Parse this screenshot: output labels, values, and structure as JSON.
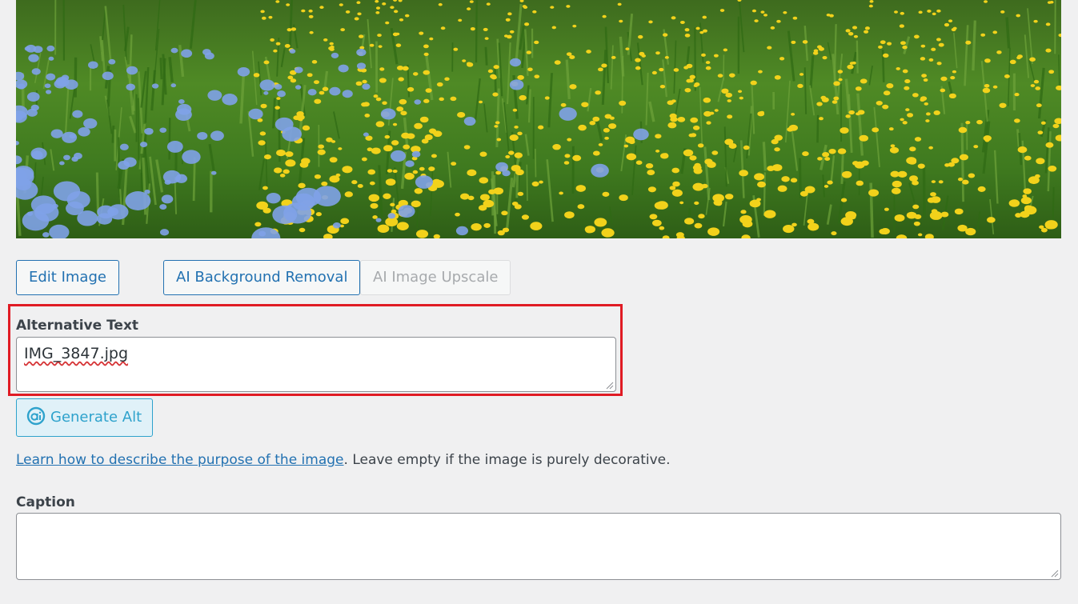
{
  "photo": {
    "description_icon": "meadow-photo",
    "colors": {
      "grass": "#4f8a25",
      "yellow_flower": "#f2d21b",
      "blue_flower": "#7fa2e8"
    }
  },
  "actions": {
    "edit_image": "Edit Image",
    "ai_background_removal": "AI Background Removal",
    "ai_image_upscale": "AI Image Upscale"
  },
  "alt_text": {
    "label": "Alternative Text",
    "value": "IMG_3847.jpg"
  },
  "generate_alt": {
    "label": "Generate Alt",
    "icon": "ai-icon"
  },
  "help": {
    "link_text": "Learn how to describe the purpose of the image",
    "suffix": ". Leave empty if the image is purely decorative."
  },
  "caption": {
    "label": "Caption",
    "value": ""
  },
  "colors": {
    "accent": "#2271b1",
    "highlight": "#e01b24",
    "generate_accent": "#2ea2cc",
    "background": "#f0f0f1"
  }
}
